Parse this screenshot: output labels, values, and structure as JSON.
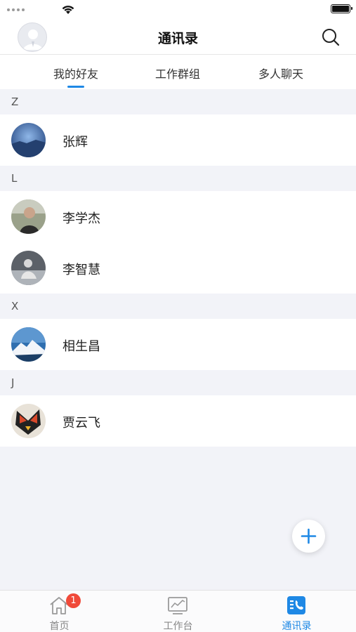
{
  "header": {
    "title": "通讯录"
  },
  "tabs": [
    {
      "label": "我的好友",
      "active": true
    },
    {
      "label": "工作群组",
      "active": false
    },
    {
      "label": "多人聊天",
      "active": false
    }
  ],
  "groups": [
    {
      "letter": "Z",
      "contacts": [
        {
          "name": "张辉",
          "avatar": "blue-landscape-avatar"
        }
      ]
    },
    {
      "letter": "L",
      "contacts": [
        {
          "name": "李学杰",
          "avatar": "man-portrait-avatar"
        },
        {
          "name": "李智慧",
          "avatar": "figure-photo-avatar"
        }
      ]
    },
    {
      "letter": "X",
      "contacts": [
        {
          "name": "相生昌",
          "avatar": "mountain-avatar"
        }
      ]
    },
    {
      "letter": "J",
      "contacts": [
        {
          "name": "贾云飞",
          "avatar": "mask-avatar"
        }
      ]
    }
  ],
  "tabbar": {
    "items": [
      {
        "label": "首页",
        "icon": "home-icon",
        "badge": "1",
        "active": false
      },
      {
        "label": "工作台",
        "icon": "chart-icon",
        "active": false
      },
      {
        "label": "通讯录",
        "icon": "contacts-icon",
        "active": true
      }
    ]
  },
  "colors": {
    "accent": "#1e88e5",
    "badge": "#f04a3a",
    "background": "#f2f3f8"
  }
}
